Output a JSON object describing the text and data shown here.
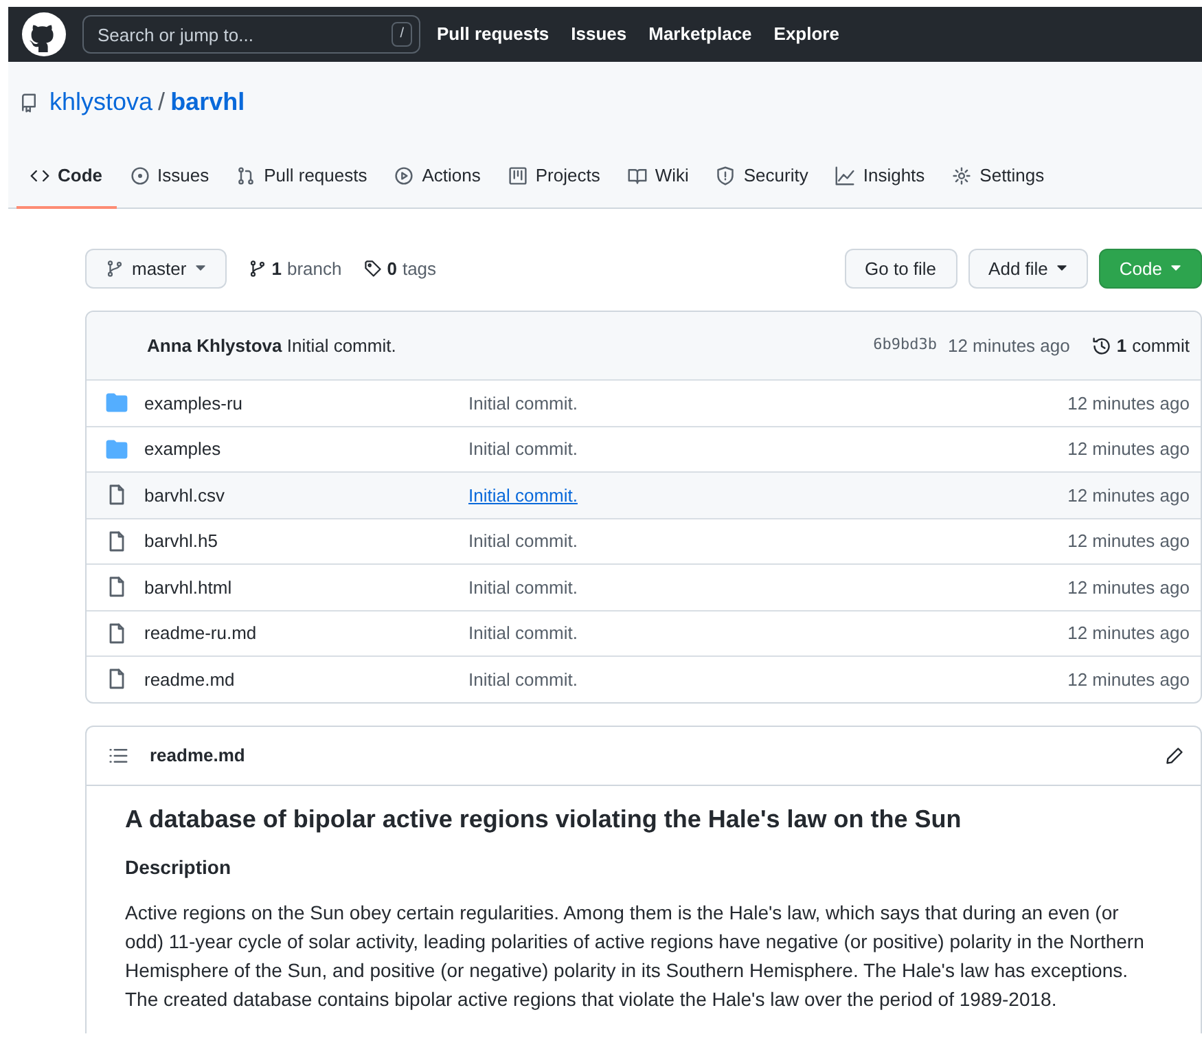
{
  "header": {
    "search": {
      "placeholder": "Search or jump to...",
      "shortcut": "/"
    },
    "links": [
      "Pull requests",
      "Issues",
      "Marketplace",
      "Explore"
    ]
  },
  "repo": {
    "owner": "khlystova",
    "separator": "/",
    "name": "barvhl"
  },
  "tabs": [
    {
      "label": "Code",
      "selected": true
    },
    {
      "label": "Issues",
      "selected": false
    },
    {
      "label": "Pull requests",
      "selected": false
    },
    {
      "label": "Actions",
      "selected": false
    },
    {
      "label": "Projects",
      "selected": false
    },
    {
      "label": "Wiki",
      "selected": false
    },
    {
      "label": "Security",
      "selected": false
    },
    {
      "label": "Insights",
      "selected": false
    },
    {
      "label": "Settings",
      "selected": false
    }
  ],
  "branch_bar": {
    "branch": "master",
    "branches": {
      "count": "1",
      "label": "branch"
    },
    "tags": {
      "count": "0",
      "label": "tags"
    },
    "buttons": [
      "Go to file",
      "Add file",
      "Code"
    ]
  },
  "commit": {
    "author": "Anna Khlystova",
    "message": "Initial commit.",
    "sha": "6b9bd3b",
    "time": "12 minutes ago",
    "commits": {
      "count": "1",
      "label": "commit"
    }
  },
  "files": [
    {
      "kind": "dir",
      "name": "examples-ru",
      "message": "Initial commit.",
      "time": "12 minutes ago",
      "hovered": false
    },
    {
      "kind": "dir",
      "name": "examples",
      "message": "Initial commit.",
      "time": "12 minutes ago",
      "hovered": false
    },
    {
      "kind": "file",
      "name": "barvhl.csv",
      "message": "Initial commit.",
      "time": "12 minutes ago",
      "hovered": true
    },
    {
      "kind": "file",
      "name": "barvhl.h5",
      "message": "Initial commit.",
      "time": "12 minutes ago",
      "hovered": false
    },
    {
      "kind": "file",
      "name": "barvhl.html",
      "message": "Initial commit.",
      "time": "12 minutes ago",
      "hovered": false
    },
    {
      "kind": "file",
      "name": "readme-ru.md",
      "message": "Initial commit.",
      "time": "12 minutes ago",
      "hovered": false
    },
    {
      "kind": "file",
      "name": "readme.md",
      "message": "Initial commit.",
      "time": "12 minutes ago",
      "hovered": false
    }
  ],
  "readme": {
    "filename": "readme.md",
    "title": "A database of bipolar active regions violating the Hale's law on the Sun",
    "section": "Description",
    "paragraph": "Active regions on the Sun obey certain regularities. Among them is the Hale's law, which says that during an even (or odd) 11-year cycle of solar activity, leading polarities of active regions have negative (or positive) polarity in the Northern Hemisphere of the Sun, and positive (or negative) polarity in its Southern Hemisphere. The Hale's law has exceptions. The created database contains bipolar active regions that violate the Hale's law over the period of 1989-2018."
  }
}
